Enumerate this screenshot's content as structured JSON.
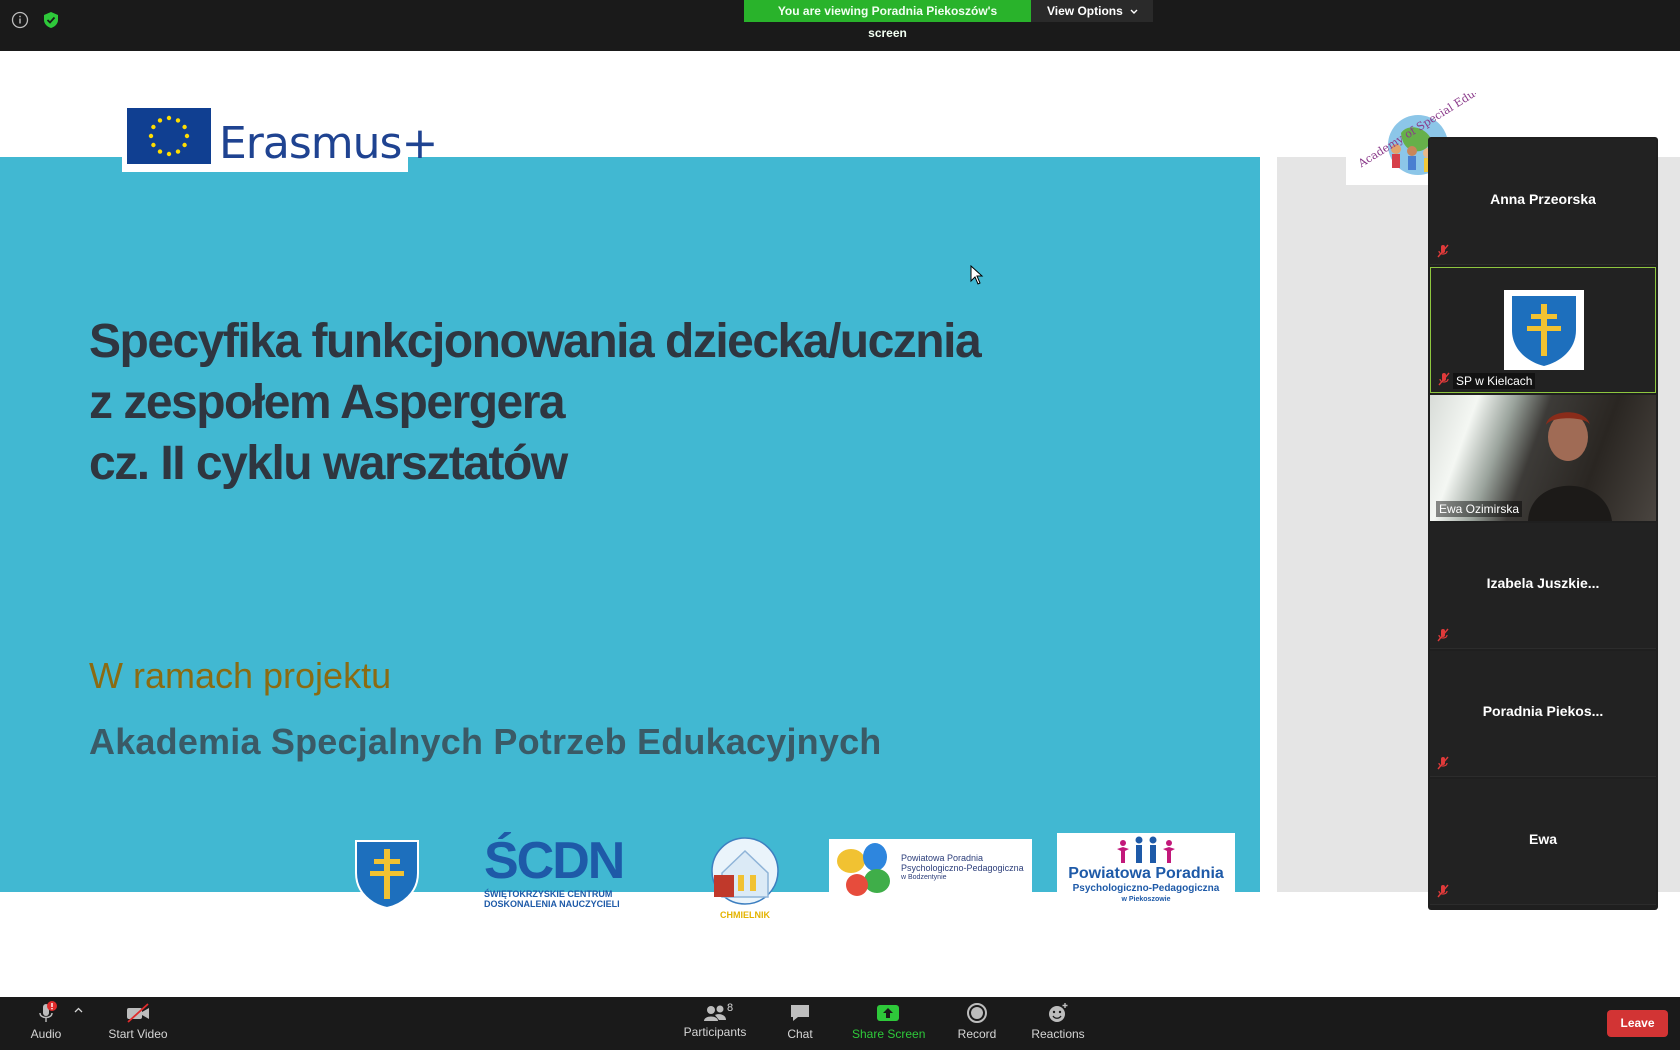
{
  "topbar": {
    "banner_text": "You are viewing Poradnia Piekoszów's screen",
    "view_options": "View Options"
  },
  "slide": {
    "erasmus_label": "Erasmus+",
    "title_lines": [
      "Specyfika funkcjonowania dziecka/ucznia",
      "z zespołem Aspergera",
      "cz. II cyklu warsztatów"
    ],
    "subtitle": "W ramach projektu",
    "project_name": "Akademia Specjalnych Potrzeb Edukacyjnych",
    "academy_logo_text": "Academy of Special Educational N",
    "logos": {
      "scdn_big": "ŚCDN",
      "scdn_line1": "ŚWIĘTOKRZYSKIE CENTRUM",
      "scdn_line2": "DOSKONALENIA NAUCZYCIELI",
      "chmielnik": "CHMIELNIK",
      "bodzentyn_line1": "Powiatowa Poradnia",
      "bodzentyn_line2": "Psychologiczno-Pedagogiczna",
      "bodzentyn_line3": "w Bodzentynie",
      "piekoszow_line1": "Powiatowa Poradnia",
      "piekoszow_line2": "Psychologiczno-Pedagogiczna",
      "piekoszow_line3": "w Piekoszowie"
    }
  },
  "participants": [
    {
      "name": "Anna Przeorska",
      "type": "name"
    },
    {
      "name": "SP w Kielcach",
      "type": "image"
    },
    {
      "name": "Ewa Ozimirska",
      "type": "video"
    },
    {
      "name": "Izabela  Juszkie...",
      "type": "name"
    },
    {
      "name": "Poradnia  Piekos...",
      "type": "name"
    },
    {
      "name": "Ewa",
      "type": "name"
    }
  ],
  "toolbar": {
    "audio": "Audio",
    "start_video": "Start Video",
    "participants_count": "8",
    "participants": "Participants",
    "chat": "Chat",
    "share_screen": "Share Screen",
    "record": "Record",
    "reactions": "Reactions",
    "leave": "Leave"
  },
  "colors": {
    "slide_blue": "#41b8d2",
    "share_green": "#2ec93a",
    "banner_green": "#29b32b",
    "leave_red": "#d23434",
    "active_tile_border": "#8ec63f"
  }
}
